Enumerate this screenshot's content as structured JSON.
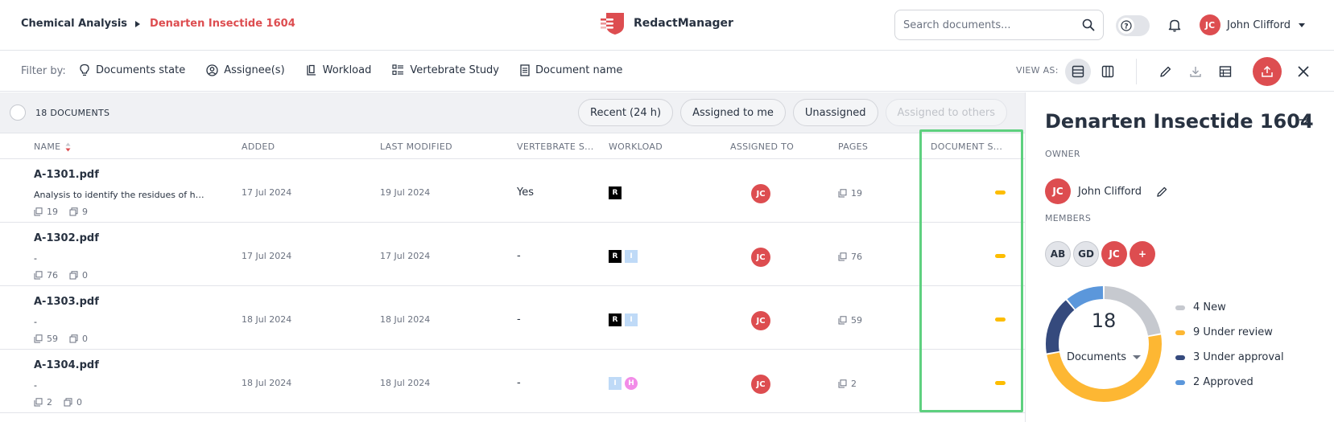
{
  "breadcrumb": {
    "parent": "Chemical Analysis",
    "current": "Denarten Insectide 1604"
  },
  "brand": {
    "name": "RedactManager"
  },
  "search": {
    "placeholder": "Search documents..."
  },
  "user": {
    "initials": "JC",
    "name": "John Clifford"
  },
  "filterbar": {
    "label": "Filter by:",
    "filters": [
      "Documents state",
      "Assignee(s)",
      "Workload",
      "Vertebrate Study",
      "Document name"
    ],
    "view_as": "VIEW AS:"
  },
  "list": {
    "count_label": "18 DOCUMENTS",
    "chips": [
      "Recent (24 h)",
      "Assigned to me",
      "Unassigned",
      "Assigned to others"
    ],
    "columns": [
      "NAME",
      "ADDED",
      "LAST MODIFIED",
      "VERTEBRATE S...",
      "WORKLOAD",
      "ASSIGNED TO",
      "PAGES",
      "DOCUMENT S..."
    ],
    "rows": [
      {
        "name": "A-1301.pdf",
        "desc": "Analysis to identify the residues of hy...",
        "pages_stat": "19",
        "redactions_stat": "9",
        "added": "17 Jul 2024",
        "modified": "19 Jul 2024",
        "vertebrate": "Yes",
        "workload": [
          "R"
        ],
        "assigned": "JC",
        "pages": "19"
      },
      {
        "name": "A-1302.pdf",
        "desc": "-",
        "pages_stat": "76",
        "redactions_stat": "0",
        "added": "17 Jul 2024",
        "modified": "17 Jul 2024",
        "vertebrate": "-",
        "workload": [
          "R",
          "I"
        ],
        "assigned": "JC",
        "pages": "76"
      },
      {
        "name": "A-1303.pdf",
        "desc": "-",
        "pages_stat": "59",
        "redactions_stat": "0",
        "added": "18 Jul 2024",
        "modified": "18 Jul 2024",
        "vertebrate": "-",
        "workload": [
          "R",
          "I"
        ],
        "assigned": "JC",
        "pages": "59"
      },
      {
        "name": "A-1304.pdf",
        "desc": "-",
        "pages_stat": "2",
        "redactions_stat": "0",
        "added": "18 Jul 2024",
        "modified": "18 Jul 2024",
        "vertebrate": "-",
        "workload": [
          "I",
          "H"
        ],
        "assigned": "JC",
        "pages": "2"
      }
    ],
    "state_color": "#fdbd00"
  },
  "panel": {
    "title": "Denarten Insectide 1604",
    "owner_label": "OWNER",
    "owner": {
      "initials": "JC",
      "name": "John Clifford"
    },
    "members_label": "MEMBERS",
    "members": [
      "AB",
      "GD",
      "JC",
      "+"
    ],
    "donut": {
      "total": "18",
      "label": "Documents",
      "segments": [
        {
          "label": "4 New",
          "value": 4,
          "color": "#c6c9cf"
        },
        {
          "label": "9 Under review",
          "value": 9,
          "color": "#fdb733"
        },
        {
          "label": "3 Under approval",
          "value": 3,
          "color": "#354a7d"
        },
        {
          "label": "2 Approved",
          "value": 2,
          "color": "#5b97db"
        }
      ]
    }
  },
  "colors": {
    "accent": "#dd4d50",
    "highlight": "#5ed07f"
  }
}
